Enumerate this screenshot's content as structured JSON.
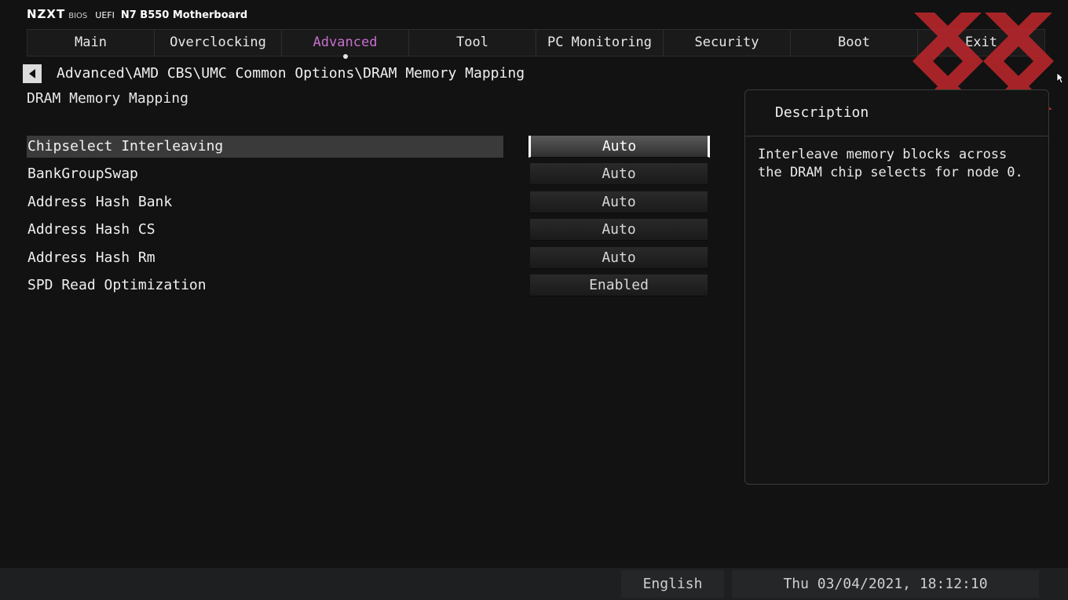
{
  "brand": {
    "logo": "NZXT",
    "bios": "BIOS",
    "uefi": "UEFI",
    "model": "N7 B550 Motherboard"
  },
  "tabs": [
    {
      "label": "Main",
      "active": false
    },
    {
      "label": "Overclocking",
      "active": false
    },
    {
      "label": "Advanced",
      "active": true
    },
    {
      "label": "Tool",
      "active": false
    },
    {
      "label": "PC Monitoring",
      "active": false
    },
    {
      "label": "Security",
      "active": false
    },
    {
      "label": "Boot",
      "active": false
    },
    {
      "label": "Exit",
      "active": false
    }
  ],
  "breadcrumb": "Advanced\\AMD CBS\\UMC Common Options\\DRAM Memory Mapping",
  "page_title": "DRAM Memory Mapping",
  "settings": [
    {
      "label": "Chipselect Interleaving",
      "value": "Auto"
    },
    {
      "label": "BankGroupSwap",
      "value": "Auto"
    },
    {
      "label": "Address Hash Bank",
      "value": "Auto"
    },
    {
      "label": "Address Hash CS",
      "value": "Auto"
    },
    {
      "label": "Address Hash Rm",
      "value": "Auto"
    },
    {
      "label": "SPD Read Optimization",
      "value": "Enabled"
    }
  ],
  "description": {
    "title": "Description",
    "text": "Interleave memory blocks across the DRAM chip selects for node 0."
  },
  "footer": {
    "language": "English",
    "datetime": "Thu 03/04/2021, 18:12:10"
  },
  "colors": {
    "active_tab": "#c76fd0",
    "watermark": "#c0282d",
    "background": "#121212"
  }
}
